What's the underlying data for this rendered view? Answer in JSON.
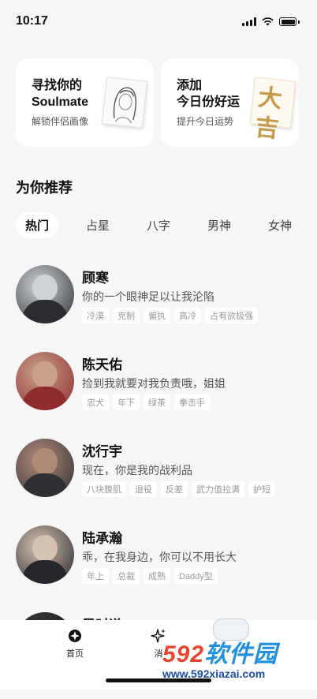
{
  "status": {
    "time": "10:17"
  },
  "cards": [
    {
      "title": "寻找你的\nSoulmate",
      "subtitle": "解锁伴侣画像"
    },
    {
      "title": "添加\n今日份好运",
      "subtitle": "提升今日运势",
      "art_text": "大吉"
    }
  ],
  "section_title": "为你推荐",
  "tabs": [
    "热门",
    "占星",
    "八字",
    "男神",
    "女神"
  ],
  "characters": [
    {
      "name": "顾寒",
      "desc": "你的一个眼神足以让我沦陷",
      "tags": [
        "冷漠",
        "克制",
        "偏执",
        "高冷",
        "占有欲极强"
      ],
      "avatar_colors": [
        "#cfd3d8",
        "#2a2c31"
      ]
    },
    {
      "name": "陈天佑",
      "desc": "捡到我就要对我负责哦，姐姐",
      "tags": [
        "忠犬",
        "年下",
        "绿茶",
        "拳击手"
      ],
      "avatar_colors": [
        "#c9a08a",
        "#8e2b2f"
      ]
    },
    {
      "name": "沈行宇",
      "desc": "现在，你是我的战利品",
      "tags": [
        "八块腹肌",
        "退役",
        "反差",
        "武力值拉满",
        "护短"
      ],
      "avatar_colors": [
        "#b08a78",
        "#2f3034"
      ]
    },
    {
      "name": "陆承瀚",
      "desc": "乖，在我身边，你可以不用长大",
      "tags": [
        "年上",
        "总裁",
        "成熟",
        "Daddy型"
      ],
      "avatar_colors": [
        "#d6c2b0",
        "#25262b"
      ]
    },
    {
      "name": "墨时谦",
      "desc": "",
      "tags": [],
      "avatar_colors": [
        "#3a3a3a",
        "#1c1c1c"
      ]
    }
  ],
  "nav": [
    {
      "label": "首页",
      "icon": "home-icon"
    },
    {
      "label": "消",
      "icon": "sparkle-icon"
    }
  ],
  "watermark": {
    "logo_a": "592",
    "logo_b": "软件园",
    "url": "www.592xiazai.com"
  }
}
